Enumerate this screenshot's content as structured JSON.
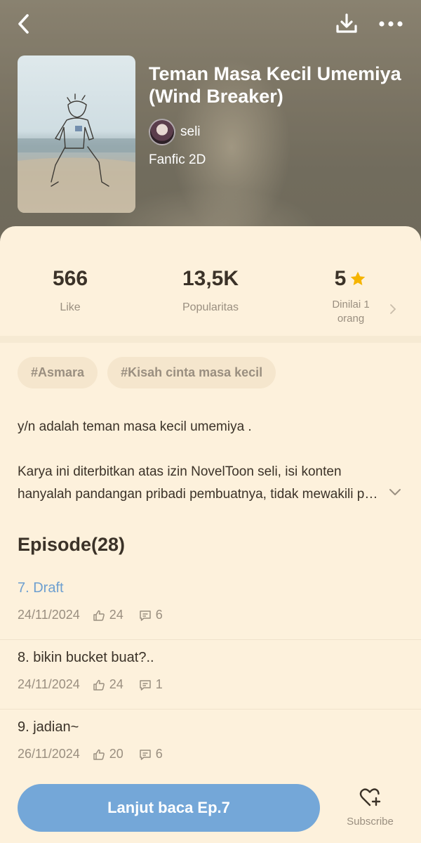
{
  "header": {
    "back_icon": "chevron-left-icon",
    "download_icon": "download-icon",
    "more_icon": "more-horizontal-icon"
  },
  "novel": {
    "title": "Teman Masa Kecil Umemiya (Wind Breaker)",
    "author": "seli",
    "genre": "Fanfic 2D"
  },
  "stats": {
    "likes_value": "566",
    "likes_label": "Like",
    "popularity_value": "13,5K",
    "popularity_label": "Popularitas",
    "rating_value": "5",
    "rating_label": "Dinilai 1 orang"
  },
  "tags": [
    "#Asmara",
    "#Kisah cinta masa kecil"
  ],
  "description": {
    "line1": "y/n adalah teman masa kecil umemiya .",
    "line2": "Karya ini diterbitkan atas izin NovelToon seli, isi konten",
    "line3": "hanyalah pandangan pribadi pembuatnya, tidak mewakili pandangan platform."
  },
  "episodes_heading": "Episode(28)",
  "episodes": [
    {
      "title": "7. Draft",
      "date": "24/11/2024",
      "likes": "24",
      "comments": "6"
    },
    {
      "title": "8. bikin bucket buat?..",
      "date": "24/11/2024",
      "likes": "24",
      "comments": "1"
    },
    {
      "title": "9. jadian~",
      "date": "26/11/2024",
      "likes": "20",
      "comments": "6"
    }
  ],
  "bottom": {
    "continue_label": "Lanjut baca Ep.7",
    "subscribe_label": "Subscribe"
  },
  "colors": {
    "accent": "#74a7d8",
    "background": "#fdf1dc",
    "star": "#f5b400"
  }
}
